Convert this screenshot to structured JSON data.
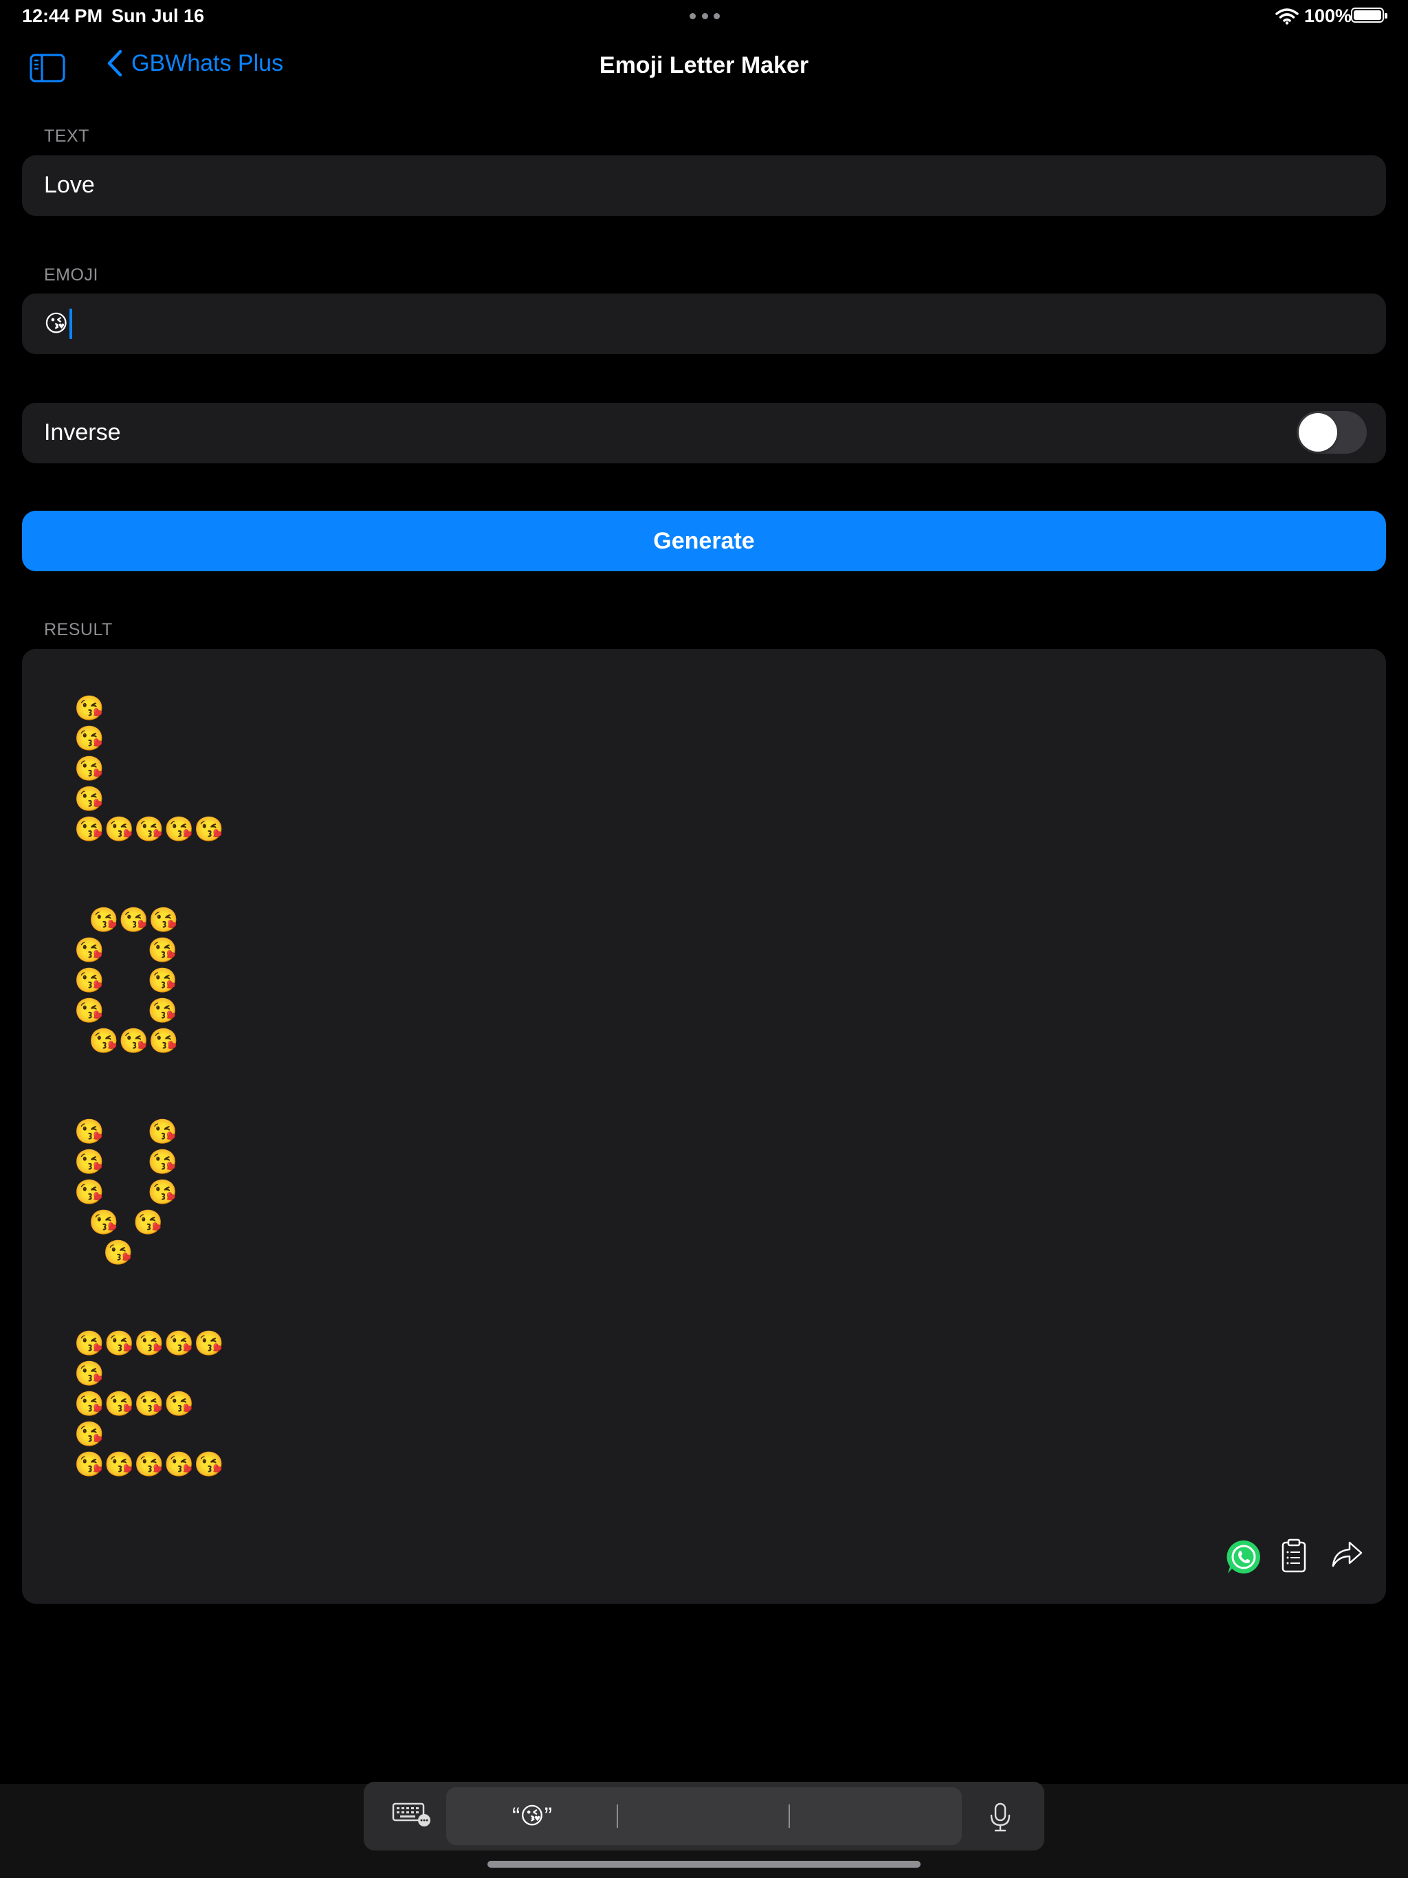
{
  "status_bar": {
    "time": "12:44 PM",
    "date": "Sun Jul 16",
    "battery": "100%"
  },
  "nav": {
    "back_label": "GBWhats Plus",
    "title": "Emoji Letter Maker"
  },
  "form": {
    "text_label": "TEXT",
    "text_value": "Love",
    "emoji_label": "EMOJI",
    "emoji_value": "😘",
    "inverse_label": "Inverse",
    "inverse_on": false,
    "generate_label": "Generate"
  },
  "result": {
    "label": "RESULT",
    "text": "😘\n😘\n😘\n😘\n😘😘😘😘😘\n\n\n 😘😘😘\n😘   😘\n😘   😘\n😘   😘\n 😘😘😘\n\n\n😘   😘\n😘   😘\n😘   😘\n 😘 😘\n  😘\n\n\n😘😘😘😘😘\n😘\n😘😘😘😘\n😘\n😘😘😘😘😘"
  },
  "keyboard_bar": {
    "suggestion": "“😘”"
  },
  "colors": {
    "accent": "#0a84ff",
    "field_bg": "#1c1c1e",
    "label_gray": "#8e8e93",
    "whatsapp_green": "#25d366"
  },
  "icons": [
    "sidebar-icon",
    "chevron-left-icon",
    "wifi-icon",
    "battery-icon",
    "whatsapp-icon",
    "clipboard-icon",
    "share-icon",
    "keyboard-icon",
    "microphone-icon"
  ]
}
